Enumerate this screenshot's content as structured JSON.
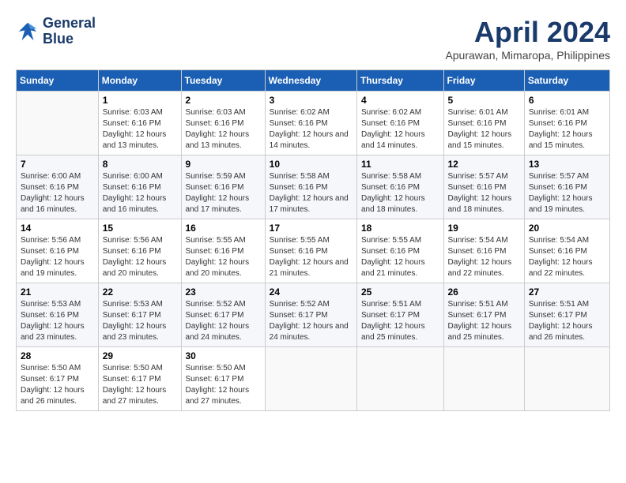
{
  "header": {
    "logo_line1": "General",
    "logo_line2": "Blue",
    "month": "April 2024",
    "location": "Apurawan, Mimaropa, Philippines"
  },
  "weekdays": [
    "Sunday",
    "Monday",
    "Tuesday",
    "Wednesday",
    "Thursday",
    "Friday",
    "Saturday"
  ],
  "weeks": [
    [
      {
        "day": "",
        "sunrise": "",
        "sunset": "",
        "daylight": ""
      },
      {
        "day": "1",
        "sunrise": "Sunrise: 6:03 AM",
        "sunset": "Sunset: 6:16 PM",
        "daylight": "Daylight: 12 hours and 13 minutes."
      },
      {
        "day": "2",
        "sunrise": "Sunrise: 6:03 AM",
        "sunset": "Sunset: 6:16 PM",
        "daylight": "Daylight: 12 hours and 13 minutes."
      },
      {
        "day": "3",
        "sunrise": "Sunrise: 6:02 AM",
        "sunset": "Sunset: 6:16 PM",
        "daylight": "Daylight: 12 hours and 14 minutes."
      },
      {
        "day": "4",
        "sunrise": "Sunrise: 6:02 AM",
        "sunset": "Sunset: 6:16 PM",
        "daylight": "Daylight: 12 hours and 14 minutes."
      },
      {
        "day": "5",
        "sunrise": "Sunrise: 6:01 AM",
        "sunset": "Sunset: 6:16 PM",
        "daylight": "Daylight: 12 hours and 15 minutes."
      },
      {
        "day": "6",
        "sunrise": "Sunrise: 6:01 AM",
        "sunset": "Sunset: 6:16 PM",
        "daylight": "Daylight: 12 hours and 15 minutes."
      }
    ],
    [
      {
        "day": "7",
        "sunrise": "Sunrise: 6:00 AM",
        "sunset": "Sunset: 6:16 PM",
        "daylight": "Daylight: 12 hours and 16 minutes."
      },
      {
        "day": "8",
        "sunrise": "Sunrise: 6:00 AM",
        "sunset": "Sunset: 6:16 PM",
        "daylight": "Daylight: 12 hours and 16 minutes."
      },
      {
        "day": "9",
        "sunrise": "Sunrise: 5:59 AM",
        "sunset": "Sunset: 6:16 PM",
        "daylight": "Daylight: 12 hours and 17 minutes."
      },
      {
        "day": "10",
        "sunrise": "Sunrise: 5:58 AM",
        "sunset": "Sunset: 6:16 PM",
        "daylight": "Daylight: 12 hours and 17 minutes."
      },
      {
        "day": "11",
        "sunrise": "Sunrise: 5:58 AM",
        "sunset": "Sunset: 6:16 PM",
        "daylight": "Daylight: 12 hours and 18 minutes."
      },
      {
        "day": "12",
        "sunrise": "Sunrise: 5:57 AM",
        "sunset": "Sunset: 6:16 PM",
        "daylight": "Daylight: 12 hours and 18 minutes."
      },
      {
        "day": "13",
        "sunrise": "Sunrise: 5:57 AM",
        "sunset": "Sunset: 6:16 PM",
        "daylight": "Daylight: 12 hours and 19 minutes."
      }
    ],
    [
      {
        "day": "14",
        "sunrise": "Sunrise: 5:56 AM",
        "sunset": "Sunset: 6:16 PM",
        "daylight": "Daylight: 12 hours and 19 minutes."
      },
      {
        "day": "15",
        "sunrise": "Sunrise: 5:56 AM",
        "sunset": "Sunset: 6:16 PM",
        "daylight": "Daylight: 12 hours and 20 minutes."
      },
      {
        "day": "16",
        "sunrise": "Sunrise: 5:55 AM",
        "sunset": "Sunset: 6:16 PM",
        "daylight": "Daylight: 12 hours and 20 minutes."
      },
      {
        "day": "17",
        "sunrise": "Sunrise: 5:55 AM",
        "sunset": "Sunset: 6:16 PM",
        "daylight": "Daylight: 12 hours and 21 minutes."
      },
      {
        "day": "18",
        "sunrise": "Sunrise: 5:55 AM",
        "sunset": "Sunset: 6:16 PM",
        "daylight": "Daylight: 12 hours and 21 minutes."
      },
      {
        "day": "19",
        "sunrise": "Sunrise: 5:54 AM",
        "sunset": "Sunset: 6:16 PM",
        "daylight": "Daylight: 12 hours and 22 minutes."
      },
      {
        "day": "20",
        "sunrise": "Sunrise: 5:54 AM",
        "sunset": "Sunset: 6:16 PM",
        "daylight": "Daylight: 12 hours and 22 minutes."
      }
    ],
    [
      {
        "day": "21",
        "sunrise": "Sunrise: 5:53 AM",
        "sunset": "Sunset: 6:16 PM",
        "daylight": "Daylight: 12 hours and 23 minutes."
      },
      {
        "day": "22",
        "sunrise": "Sunrise: 5:53 AM",
        "sunset": "Sunset: 6:17 PM",
        "daylight": "Daylight: 12 hours and 23 minutes."
      },
      {
        "day": "23",
        "sunrise": "Sunrise: 5:52 AM",
        "sunset": "Sunset: 6:17 PM",
        "daylight": "Daylight: 12 hours and 24 minutes."
      },
      {
        "day": "24",
        "sunrise": "Sunrise: 5:52 AM",
        "sunset": "Sunset: 6:17 PM",
        "daylight": "Daylight: 12 hours and 24 minutes."
      },
      {
        "day": "25",
        "sunrise": "Sunrise: 5:51 AM",
        "sunset": "Sunset: 6:17 PM",
        "daylight": "Daylight: 12 hours and 25 minutes."
      },
      {
        "day": "26",
        "sunrise": "Sunrise: 5:51 AM",
        "sunset": "Sunset: 6:17 PM",
        "daylight": "Daylight: 12 hours and 25 minutes."
      },
      {
        "day": "27",
        "sunrise": "Sunrise: 5:51 AM",
        "sunset": "Sunset: 6:17 PM",
        "daylight": "Daylight: 12 hours and 26 minutes."
      }
    ],
    [
      {
        "day": "28",
        "sunrise": "Sunrise: 5:50 AM",
        "sunset": "Sunset: 6:17 PM",
        "daylight": "Daylight: 12 hours and 26 minutes."
      },
      {
        "day": "29",
        "sunrise": "Sunrise: 5:50 AM",
        "sunset": "Sunset: 6:17 PM",
        "daylight": "Daylight: 12 hours and 27 minutes."
      },
      {
        "day": "30",
        "sunrise": "Sunrise: 5:50 AM",
        "sunset": "Sunset: 6:17 PM",
        "daylight": "Daylight: 12 hours and 27 minutes."
      },
      {
        "day": "",
        "sunrise": "",
        "sunset": "",
        "daylight": ""
      },
      {
        "day": "",
        "sunrise": "",
        "sunset": "",
        "daylight": ""
      },
      {
        "day": "",
        "sunrise": "",
        "sunset": "",
        "daylight": ""
      },
      {
        "day": "",
        "sunrise": "",
        "sunset": "",
        "daylight": ""
      }
    ]
  ]
}
